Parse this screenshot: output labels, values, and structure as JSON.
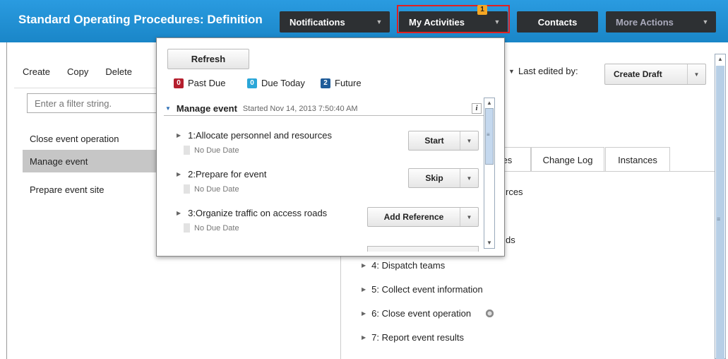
{
  "header": {
    "title": "Standard Operating Procedures: Definition",
    "notifications_label": "Notifications",
    "my_activities_label": "My Activities",
    "my_activities_count": "1",
    "contacts_label": "Contacts",
    "more_actions_label": "More Actions"
  },
  "toolbar": {
    "create": "Create",
    "copy": "Copy",
    "delete": "Delete"
  },
  "filter": {
    "placeholder": "Enter a filter string."
  },
  "tree": {
    "items": [
      "Close event operation",
      "Manage event",
      "Prepare event site"
    ],
    "selected": "Manage event"
  },
  "right": {
    "last_edited_label": "Last edited by:",
    "create_draft_label": "Create Draft",
    "tabs": [
      "ces",
      "Change Log",
      "Instances"
    ],
    "fragments": {
      "rces": "rces",
      "ds": "ds"
    },
    "steps": [
      "4: Dispatch teams",
      "5: Collect event information",
      "6: Close event operation",
      "7: Report event results"
    ]
  },
  "popup": {
    "refresh_label": "Refresh",
    "legend": [
      {
        "count": "0",
        "label": "Past Due",
        "color": "#b51f2e"
      },
      {
        "count": "0",
        "label": "Due Today",
        "color": "#2aa6d8"
      },
      {
        "count": "2",
        "label": "Future",
        "color": "#1f5c99"
      }
    ],
    "event": {
      "name": "Manage event",
      "started": "Started Nov 14, 2013 7:50:40 AM"
    },
    "activities": [
      {
        "title": "1:Allocate personnel and resources",
        "due": "No Due Date",
        "action": "Start"
      },
      {
        "title": "2:Prepare for event",
        "due": "No Due Date",
        "action": "Skip"
      },
      {
        "title": "3:Organize traffic on access roads",
        "due": "No Due Date",
        "action": "Add Reference"
      }
    ]
  },
  "colors": {
    "banner": "#1e8fd2",
    "nav_button": "#2d3033",
    "highlight": "#e02020",
    "badge": "#f5a623"
  }
}
